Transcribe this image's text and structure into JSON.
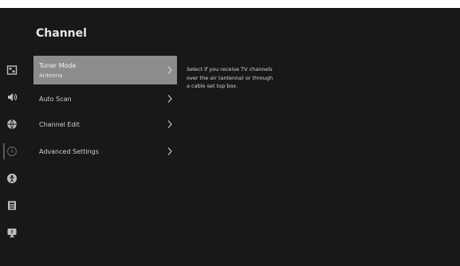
{
  "header": {
    "title": "Channel"
  },
  "sidebar": {
    "icons": [
      {
        "name": "picture-icon",
        "active": false
      },
      {
        "name": "sound-icon",
        "active": false
      },
      {
        "name": "network-icon",
        "active": false
      },
      {
        "name": "channel-icon",
        "active": true
      },
      {
        "name": "accessibility-icon",
        "active": false
      },
      {
        "name": "system-icon",
        "active": false
      },
      {
        "name": "support-icon",
        "active": false
      }
    ]
  },
  "menu": {
    "items": [
      {
        "label": "Tuner Mode",
        "value": "Antenna",
        "selected": true
      },
      {
        "label": "Auto Scan",
        "selected": false
      },
      {
        "label": "Channel Edit",
        "selected": false
      },
      {
        "label": "Advanced Settings",
        "selected": false
      }
    ]
  },
  "help": {
    "text": "Select if you receive TV channels over the air (antenna) or through a cable set top box."
  },
  "colors": {
    "background": "#181818",
    "highlight": "#8c8c8c",
    "text": "#d0d0d0"
  }
}
